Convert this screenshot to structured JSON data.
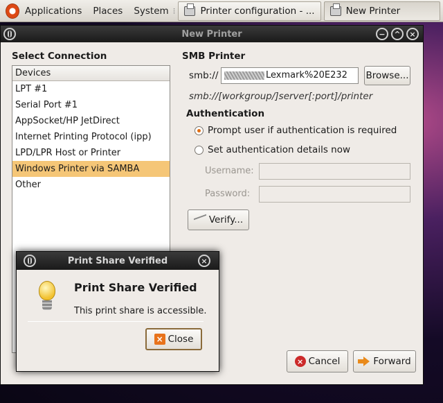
{
  "panel": {
    "menus": [
      "Applications",
      "Places",
      "System"
    ],
    "tasks": [
      {
        "label": "Printer configuration - ..."
      },
      {
        "label": "New Printer"
      }
    ]
  },
  "window": {
    "title": "New Printer",
    "select_connection_heading": "Select Connection",
    "list_header": "Devices",
    "devices": [
      "LPT #1",
      "Serial Port #1",
      "AppSocket/HP JetDirect",
      "Internet Printing Protocol (ipp)",
      "LPD/LPR Host or Printer",
      "Windows Printer via SAMBA",
      "Other"
    ],
    "selected_device": "Windows Printer via SAMBA",
    "smb": {
      "heading": "SMB Printer",
      "prefix_label": "smb://",
      "uri_value": "Lexmark%20E232",
      "browse_label": "Browse...",
      "format_hint": "smb://[workgroup/]server[:port]/printer"
    },
    "auth": {
      "heading": "Authentication",
      "option_prompt": "Prompt user if authentication is required",
      "option_set": "Set authentication details now",
      "selected": "prompt",
      "username_label": "Username:",
      "password_label": "Password:",
      "username_value": "",
      "password_value": ""
    },
    "verify_label": "Verify...",
    "cancel_label": "Cancel",
    "forward_label": "Forward"
  },
  "dialog": {
    "title": "Print Share Verified",
    "heading": "Print Share Verified",
    "message": "This print share is accessible.",
    "close_label": "Close"
  }
}
